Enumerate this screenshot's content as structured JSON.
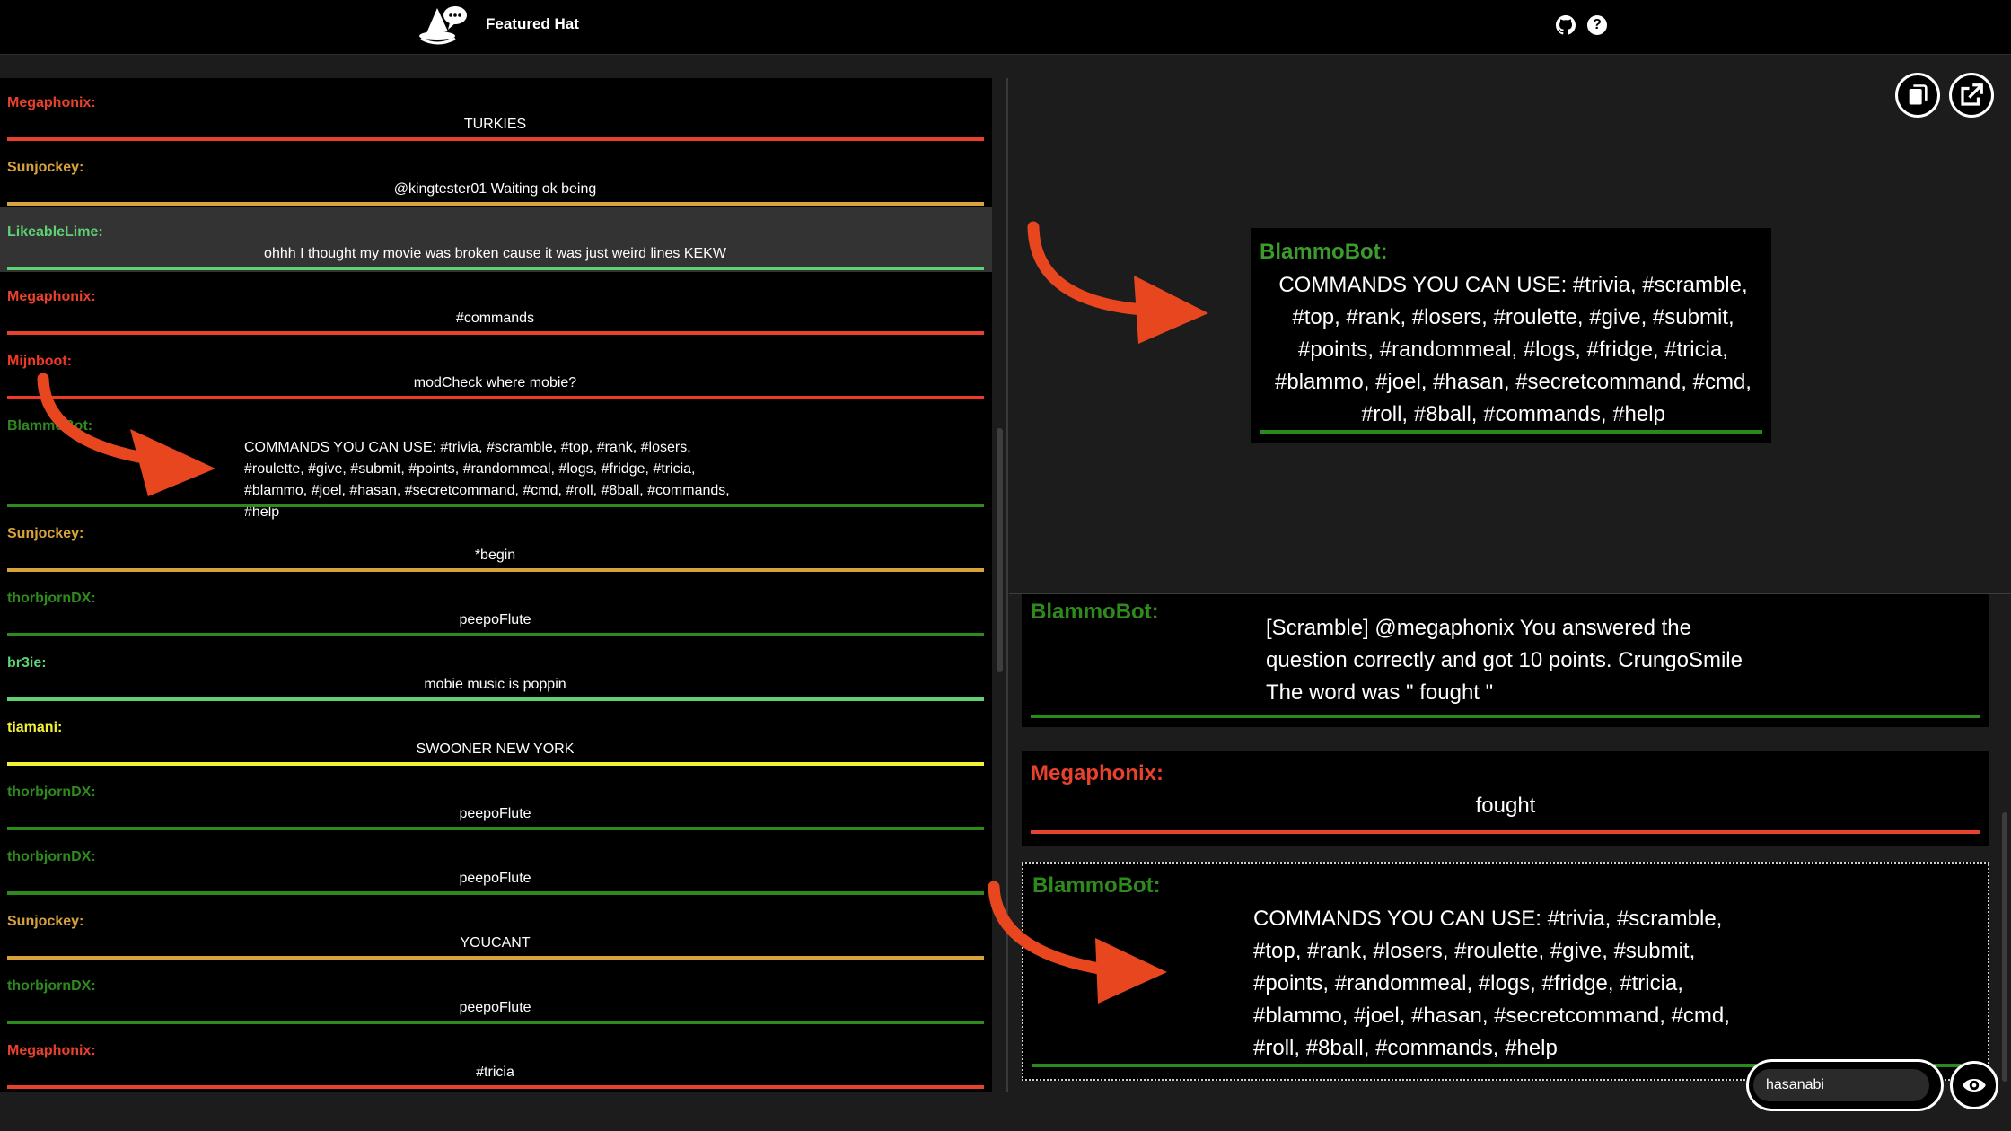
{
  "header": {
    "title": "Featured Hat",
    "github_icon": "github-icon",
    "help_icon": "help-icon"
  },
  "colors": {
    "megaphonix": "#e8412c",
    "sunjockey": "#d9a33b",
    "likeablelime": "#5ed175",
    "mijnboot": "#ef3b24",
    "blammobot": "#2f8a1d",
    "thorbjorndx": "#2f8a1d",
    "br3ie": "#5ed175",
    "tiamani": "#f2f233",
    "annotation_arrow": "#e8461f"
  },
  "chat": {
    "messages": [
      {
        "user": "Megaphonix:",
        "text": "TURKIES",
        "color": "#e8412c"
      },
      {
        "user": "Sunjockey:",
        "text": "@kingtester01 Waiting ok being",
        "color": "#d9a33b"
      },
      {
        "user": "LikeableLime:",
        "text": "ohhh I thought my movie was broken cause it was just weird lines KEKW",
        "color": "#5ed175"
      },
      {
        "user": "Megaphonix:",
        "text": "#commands",
        "color": "#e8412c"
      },
      {
        "user": "Mijnboot:",
        "text": "modCheck where mobie?",
        "color": "#ef3b24"
      },
      {
        "user": "BlammoBot:",
        "text": "COMMANDS YOU CAN USE: #trivia, #scramble, #top, #rank, #losers, #roulette, #give, #submit, #points, #randommeal, #logs, #fridge, #tricia, #blammo, #joel, #hasan, #secretcommand, #cmd, #roll, #8ball, #commands, #help",
        "color": "#2f8a1d"
      },
      {
        "user": "Sunjockey:",
        "text": "*begin",
        "color": "#d9a33b"
      },
      {
        "user": "thorbjornDX:",
        "text": "peepoFlute",
        "color": "#2f8a1d"
      },
      {
        "user": "br3ie:",
        "text": "mobie music is poppin",
        "color": "#5ed175"
      },
      {
        "user": "tiamani:",
        "text": "SWOONER NEW YORK",
        "color": "#f2f233"
      },
      {
        "user": "thorbjornDX:",
        "text": "peepoFlute",
        "color": "#2f8a1d"
      },
      {
        "user": "thorbjornDX:",
        "text": "peepoFlute",
        "color": "#2f8a1d"
      },
      {
        "user": "Sunjockey:",
        "text": "YOUCANT",
        "color": "#d9a33b"
      },
      {
        "user": "thorbjornDX:",
        "text": "peepoFlute",
        "color": "#2f8a1d"
      },
      {
        "user": "Megaphonix:",
        "text": "#tricia",
        "color": "#e8412c"
      }
    ]
  },
  "featured": {
    "user": "BlammoBot:",
    "text": "COMMANDS YOU CAN USE: #trivia, #scramble, #top, #rank, #losers, #roulette, #give, #submit, #points, #randommeal, #logs, #fridge, #tricia, #blammo, #joel, #hasan, #secretcommand, #cmd, #roll, #8ball, #commands, #help",
    "copy_icon": "copy-icon",
    "popout_icon": "external-link-icon"
  },
  "history": {
    "items": [
      {
        "user": "BlammoBot:",
        "text": "[Scramble] @megaphonix You answered the question correctly and got 10 points. CrungoSmile The word was \" fought \""
      },
      {
        "user": "Megaphonix:",
        "text": "fought"
      },
      {
        "user": "BlammoBot:",
        "text": "COMMANDS YOU CAN USE: #trivia, #scramble, #top, #rank, #losers, #roulette, #give, #submit, #points, #randommeal, #logs, #fridge, #tricia, #blammo, #joel, #hasan, #secretcommand, #cmd, #roll, #8ball, #commands, #help"
      }
    ]
  },
  "channel": {
    "value": "hasanabi",
    "eye_icon": "eye-icon"
  }
}
